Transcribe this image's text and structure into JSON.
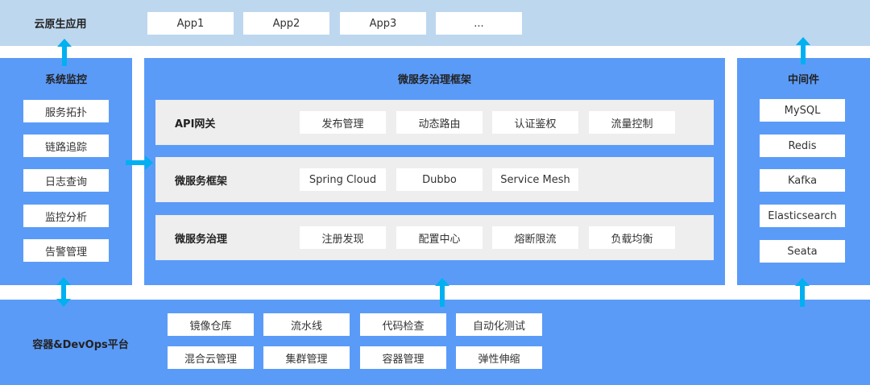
{
  "top": {
    "title": "云原生应用",
    "apps": [
      "App1",
      "App2",
      "App3",
      "..."
    ]
  },
  "left": {
    "title": "系统监控",
    "items": [
      "服务拓扑",
      "链路追踪",
      "日志查询",
      "监控分析",
      "告警管理"
    ]
  },
  "center": {
    "title": "微服务治理框架",
    "rows": [
      {
        "label": "API网关",
        "items": [
          "发布管理",
          "动态路由",
          "认证鉴权",
          "流量控制"
        ]
      },
      {
        "label": "微服务框架",
        "items": [
          "Spring Cloud",
          "Dubbo",
          "Service Mesh"
        ]
      },
      {
        "label": "微服务治理",
        "items": [
          "注册发现",
          "配置中心",
          "熔断限流",
          "负载均衡"
        ]
      }
    ]
  },
  "right": {
    "title": "中间件",
    "items": [
      "MySQL",
      "Redis",
      "Kafka",
      "Elasticsearch",
      "Seata"
    ]
  },
  "bottom": {
    "title": "容器&DevOps平台",
    "row1": [
      "镜像仓库",
      "流水线",
      "代码检查",
      "自动化测试"
    ],
    "row2": [
      "混合云管理",
      "集群管理",
      "容器管理",
      "弹性伸缩"
    ]
  },
  "colors": {
    "light": "#bdd7ee",
    "panel": "#5b9bf8",
    "arrow": "#00b0f0",
    "row": "#eeeeee"
  }
}
